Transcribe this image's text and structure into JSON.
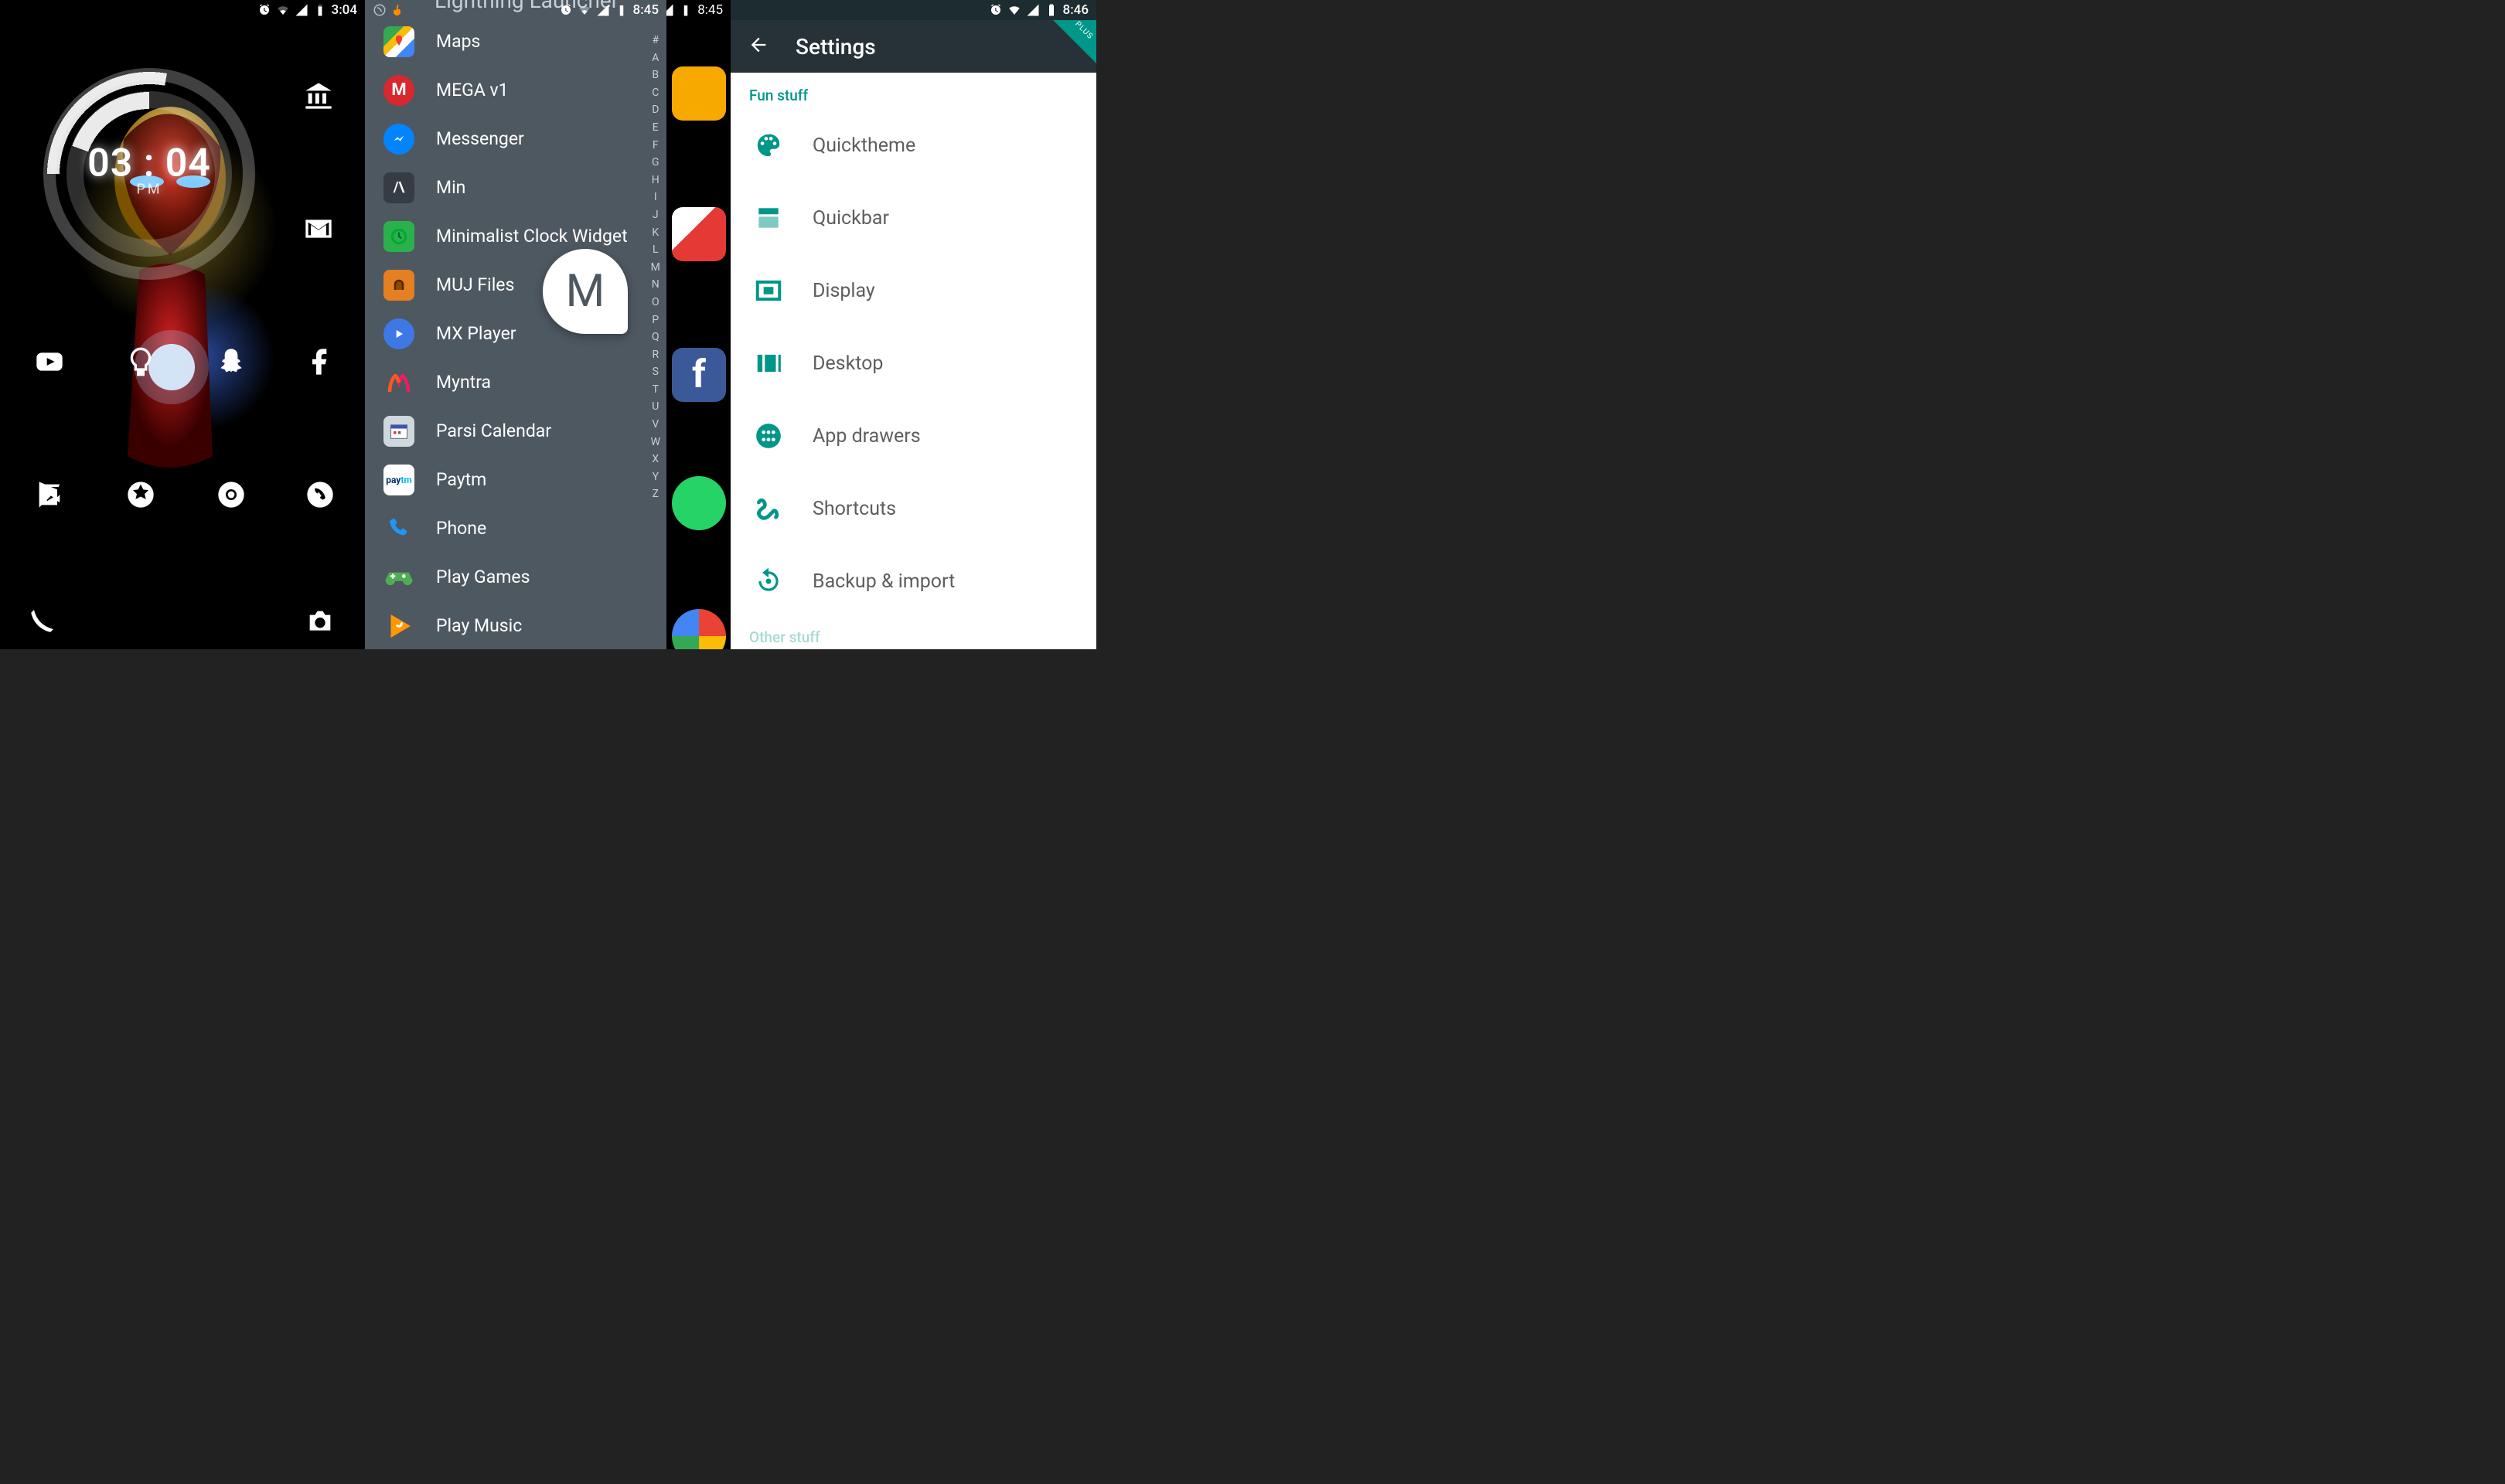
{
  "screen1": {
    "status_time": "3:04",
    "clock_time": "03 : 04",
    "clock_ampm": "PM"
  },
  "screen2": {
    "status_time_panel": "8:45",
    "status_time_behind": "8:45",
    "header_title": "Lightning Launcher",
    "bubble_letter": "M",
    "apps": [
      {
        "label": "Maps"
      },
      {
        "label": "MEGA v1"
      },
      {
        "label": "Messenger"
      },
      {
        "label": "Min"
      },
      {
        "label": "Minimalist Clock Widget"
      },
      {
        "label": "MUJ Files"
      },
      {
        "label": "MX Player"
      },
      {
        "label": "Myntra"
      },
      {
        "label": "Parsi Calendar"
      },
      {
        "label": "Paytm"
      },
      {
        "label": "Phone"
      },
      {
        "label": "Play Games"
      },
      {
        "label": "Play Music"
      }
    ],
    "index": [
      "#",
      "A",
      "B",
      "C",
      "D",
      "E",
      "F",
      "G",
      "H",
      "I",
      "J",
      "K",
      "L",
      "M",
      "N",
      "O",
      "P",
      "Q",
      "R",
      "S",
      "T",
      "U",
      "V",
      "W",
      "X",
      "Y",
      "Z"
    ]
  },
  "screen3": {
    "status_time": "8:46",
    "title": "Settings",
    "ribbon": "PLUS",
    "section": "Fun stuff",
    "section2": "Other stuff",
    "items": [
      {
        "label": "Quicktheme"
      },
      {
        "label": "Quickbar"
      },
      {
        "label": "Display"
      },
      {
        "label": "Desktop"
      },
      {
        "label": "App drawers"
      },
      {
        "label": "Shortcuts"
      },
      {
        "label": "Backup & import"
      }
    ]
  }
}
